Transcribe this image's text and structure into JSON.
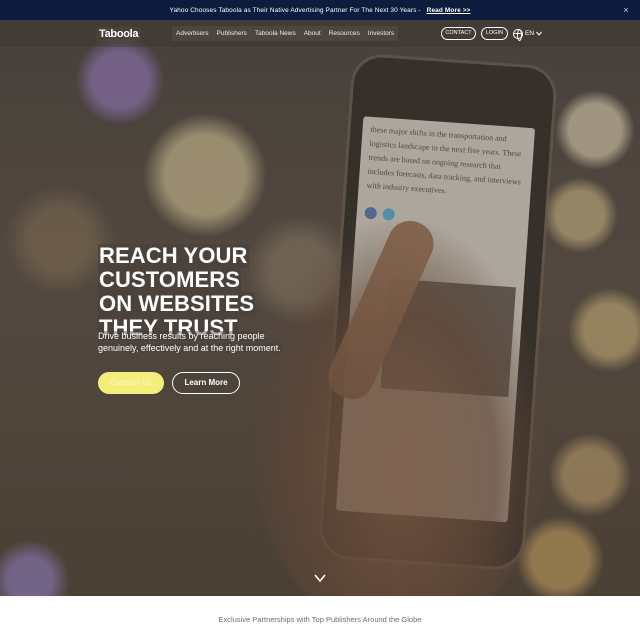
{
  "announcement": {
    "text": "Yahoo Chooses Taboola as Their Native Advertising Partner For The Next 30 Years -",
    "link": "Read More >>",
    "close": "×"
  },
  "nav": {
    "logo": "Taboola",
    "menu": [
      "Advertisers",
      "Publishers",
      "Taboola News",
      "About",
      "Resources",
      "Investors"
    ],
    "contact": "CONTACT",
    "login": "LOGIN",
    "language": "EN"
  },
  "hero": {
    "headline": [
      "REACH YOUR",
      "CUSTOMERS",
      "ON WEBSITES",
      "THEY TRUST"
    ],
    "subtext": "Drive business results by reaching people genuinely, effectively and at the right moment.",
    "primary_cta": "Contact Us",
    "secondary_cta": "Learn More",
    "phone_article": "these major shifts in the transportation and logistics landscape in the next five years. These trends are based on ongoing research that includes forecasts, data tracking, and interviews with industry executives."
  },
  "partners": {
    "text": "Exclusive Partnerships with Top Publishers Around the Globe"
  }
}
